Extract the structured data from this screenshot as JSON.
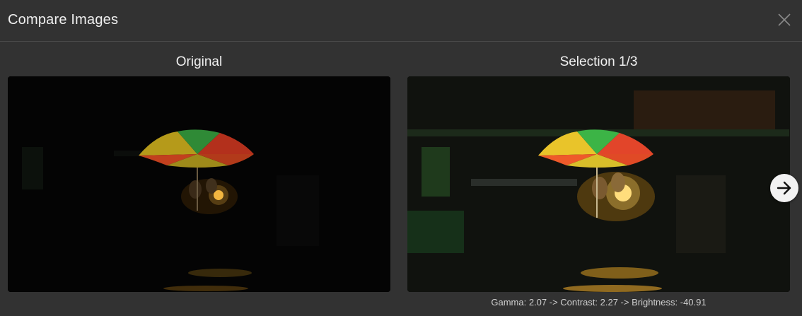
{
  "dialog": {
    "title": "Compare Images",
    "close_icon": "close-icon"
  },
  "panels": {
    "original": {
      "title": "Original"
    },
    "selection": {
      "title": "Selection 1/3",
      "caption": "Gamma: 2.07 -> Contrast: 2.27 -> Brightness: -40.91"
    }
  },
  "navigation": {
    "next_icon": "arrow-right-icon"
  },
  "colors": {
    "background": "#323232",
    "divider": "#4a4a4a",
    "text": "#f0f0f0",
    "caption_text": "#cfcfcf",
    "button_bg": "#f2f2f2"
  }
}
